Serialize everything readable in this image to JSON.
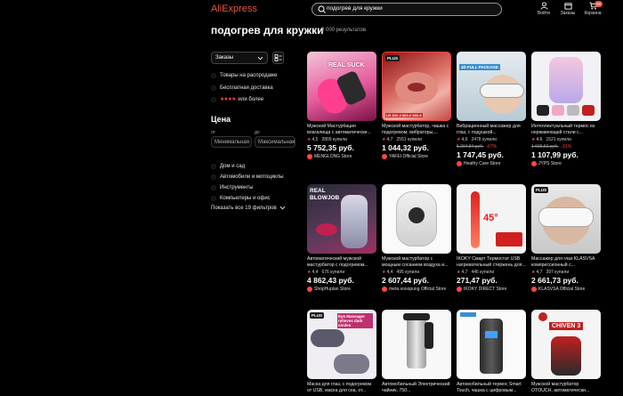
{
  "header": {
    "logo": "AliExpress",
    "search_value": "подогрев для кружки",
    "login_label": "Войти",
    "orders_label": "Заказы",
    "cart_label": "Корзина",
    "cart_count": "56"
  },
  "title": {
    "query": "подогрев для кружки",
    "count": "2 000 результатов"
  },
  "filters": {
    "sort": "Заказы",
    "checkbox_sale": "Товары на распродаже",
    "checkbox_free_delivery": "Бесплатная доставка",
    "checkbox_rating": "или более",
    "price_heading": "Цена",
    "from_label": "от",
    "to_label": "до",
    "min_placeholder": "Минимальная",
    "max_placeholder": "Максимальная",
    "categories": [
      "Дом и сад",
      "Автомобили и мотоциклы",
      "Инструменты",
      "Компьютеры и офис"
    ],
    "show_all": "Показать все 19 фильтров"
  },
  "products": [
    {
      "name": "Мужской Мастурбация влагалища с автоматически...",
      "rating": "4,5",
      "sold": "2809 купили",
      "old": "",
      "discount": "",
      "price": "5 752,35 руб.",
      "store": "MENGLONG Store",
      "img_text": "REAL SUCK",
      "plus": ""
    },
    {
      "name": "Мужской мастурбатор, чашка с подогревом, вибраторы,...",
      "rating": "4,7",
      "sold": "2551 купили",
      "old": "",
      "discount": "",
      "price": "1 044,32 руб.",
      "store": "YAFEI Official Store",
      "img_text": "US $30-3  $60-6  $90-9",
      "plus": "PLUS"
    },
    {
      "name": "Вибрационный массажер для глаз, с подушкой...",
      "rating": "4,6",
      "sold": "2478 купили",
      "old": "5 204,84 руб.",
      "discount": "-67%",
      "price": "1 747,45 руб.",
      "store": "Heathy Care Store",
      "img_text": "4D FULL PACKAGE",
      "plus": ""
    },
    {
      "name": "Интеллектуальный термос из нержавеющей стали с...",
      "rating": "4,6",
      "sold": "1521 купили",
      "old": "1 606,52 руб.",
      "discount": "-31%",
      "price": "1 107,99 руб.",
      "store": "JYPS Store",
      "img_text": "",
      "plus": ""
    },
    {
      "name": "Автоматический мужской мастурбатор с подогревом...",
      "rating": "4,4",
      "sold": "676 купили",
      "old": "",
      "discount": "",
      "price": "4 862,43 руб.",
      "store": "ShopHuplan Store",
      "img_text": "REAL BLOWJOB",
      "plus": ""
    },
    {
      "name": "Мужской мастурбатор с мощным сосанием воздуха и...",
      "rating": "4,4",
      "sold": "495 купили",
      "old": "",
      "discount": "",
      "price": "2 607,44 руб.",
      "store": "meta vooopung Official Store",
      "img_text": "",
      "plus": ""
    },
    {
      "name": "IKOKY Смарт Термостат USB нагревательный стержень для...",
      "rating": "4,7",
      "sold": "446 купили",
      "old": "",
      "discount": "",
      "price": "271,47 руб.",
      "store": "IKOKY DIRECT Store",
      "img_text": "45°",
      "plus": ""
    },
    {
      "name": "Массажер для глаз KLASVSA компрессионный с...",
      "rating": "4,7",
      "sold": "397 купили",
      "old": "",
      "discount": "",
      "price": "2 661,73 руб.",
      "store": "KLASVSA Official Store",
      "img_text": "",
      "plus": "PLUS"
    },
    {
      "name": "Маска для глаз, с подогревом от USB, маска для сна, от...",
      "rating": "",
      "sold": "",
      "old": "",
      "discount": "",
      "price": "",
      "store": "",
      "img_text": "Eye Massager relieves dark circles",
      "plus": "PLUS"
    },
    {
      "name": "Автомобильный Электрический чайник, 750...",
      "rating": "",
      "sold": "",
      "old": "",
      "discount": "",
      "price": "",
      "store": "",
      "img_text": "",
      "plus": ""
    },
    {
      "name": "Автомобильный термос Smart Touch, чашка с цифровым...",
      "rating": "",
      "sold": "",
      "old": "",
      "discount": "",
      "price": "",
      "store": "",
      "img_text": "",
      "plus": ""
    },
    {
      "name": "Мужской мастурбатор OTOUCH, автоматически...",
      "rating": "",
      "sold": "",
      "old": "",
      "discount": "",
      "price": "",
      "store": "",
      "img_text": "CHIVEN 3",
      "plus": ""
    }
  ],
  "colors": {
    "accent": "#ff4747",
    "logo": "#e9573f",
    "background": "#000000"
  }
}
